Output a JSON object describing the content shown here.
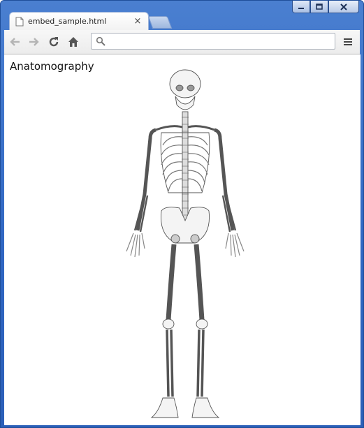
{
  "window": {
    "controls": [
      "minimize",
      "maximize",
      "close"
    ]
  },
  "tab": {
    "title": "embed_sample.html",
    "close_glyph": "×"
  },
  "toolbar": {
    "back_icon": "arrow-left-icon",
    "forward_icon": "arrow-right-icon",
    "reload_icon": "reload-icon",
    "home_icon": "home-icon",
    "search_icon": "search-icon",
    "address_value": "",
    "menu_icon": "hamburger-menu-icon"
  },
  "page": {
    "heading": "Anatomography",
    "figure": "human-skeleton-front-view"
  },
  "colors": {
    "frame": "#2f66c2",
    "toolbar": "#f0f0f0",
    "page_bg": "#ffffff"
  }
}
